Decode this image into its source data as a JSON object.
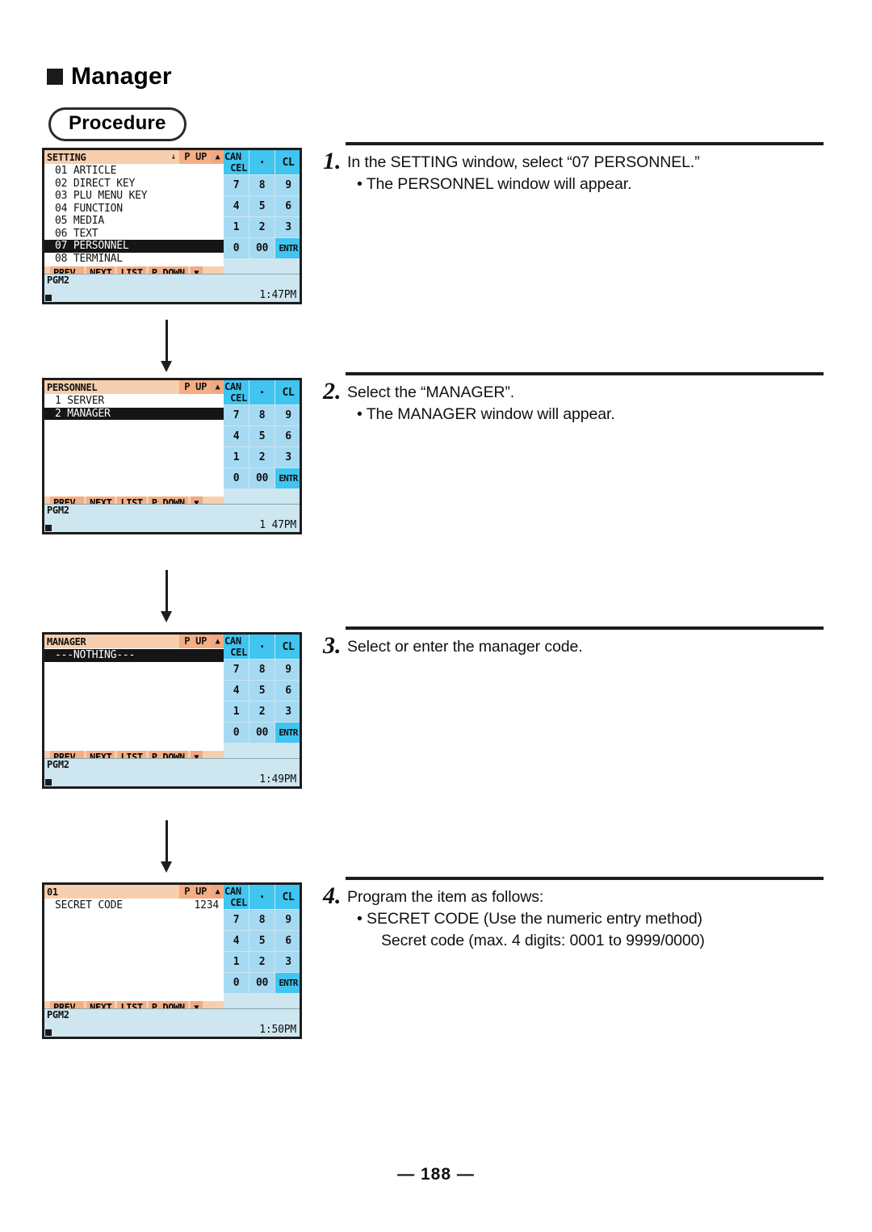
{
  "heading": {
    "bullet_icon": "filled-square",
    "title": "Manager",
    "badge": "Procedure"
  },
  "panels": [
    {
      "id": "setting",
      "title": "SETTING",
      "title_down_arrow": "↓",
      "page_up_label": "P UP",
      "title_up_arrow": "▲",
      "rows": [
        {
          "label": "01 ARTICLE",
          "value": "",
          "selected": false
        },
        {
          "label": "02 DIRECT KEY",
          "value": "",
          "selected": false
        },
        {
          "label": "03 PLU MENU KEY",
          "value": "",
          "selected": false
        },
        {
          "label": "04 FUNCTION",
          "value": "",
          "selected": false
        },
        {
          "label": "05 MEDIA",
          "value": "",
          "selected": false
        },
        {
          "label": "06 TEXT",
          "value": "",
          "selected": false
        },
        {
          "label": "07 PERSONNEL",
          "value": "",
          "selected": true
        },
        {
          "label": "08 TERMINAL",
          "value": "",
          "selected": false
        }
      ],
      "bottom_keys": [
        "PREV.",
        "NEXT",
        "LIST",
        "P DOWN"
      ],
      "bottom_down_arrow": "▼",
      "mode": "PGM2",
      "time": "1:47PM"
    },
    {
      "id": "personnel",
      "title": "PERSONNEL",
      "title_down_arrow": "",
      "page_up_label": "P UP",
      "title_up_arrow": "▲",
      "rows": [
        {
          "label": "1 SERVER",
          "value": "",
          "selected": false
        },
        {
          "label": "2 MANAGER",
          "value": "",
          "selected": true
        }
      ],
      "bottom_keys": [
        "PREV.",
        "NEXT",
        "LIST",
        "P DOWN"
      ],
      "bottom_down_arrow": "▼",
      "mode": "PGM2",
      "time": "1 47PM"
    },
    {
      "id": "manager",
      "title": "MANAGER",
      "title_down_arrow": "",
      "page_up_label": "P UP",
      "title_up_arrow": "▲",
      "rows": [
        {
          "label": "---NOTHING---",
          "value": "",
          "selected": true
        }
      ],
      "bottom_keys": [
        "PREV.",
        "NEXT",
        "LIST",
        "P DOWN"
      ],
      "bottom_down_arrow": "▼",
      "mode": "PGM2",
      "time": "1:49PM"
    },
    {
      "id": "manager-01",
      "title": "01",
      "title_down_arrow": "",
      "page_up_label": "P UP",
      "title_up_arrow": "▲",
      "rows": [
        {
          "label": "SECRET CODE",
          "value": "1234",
          "selected": false
        }
      ],
      "bottom_keys": [
        "PREV.",
        "NEXT",
        "LIST",
        "P DOWN"
      ],
      "bottom_down_arrow": "▼",
      "mode": "PGM2",
      "time": "1:50PM"
    }
  ],
  "keypad": {
    "cancel_top": "CAN",
    "cancel_bottom": "CEL",
    "dot": "·",
    "clear": "CL",
    "keys": [
      "7",
      "8",
      "9",
      "4",
      "5",
      "6",
      "1",
      "2",
      "3",
      "0",
      "00"
    ],
    "enter": "ENTR"
  },
  "steps": [
    {
      "num": "1.",
      "text": "In the SETTING window, select “07 PERSONNEL.”",
      "sub": "• The PERSONNEL window will appear.",
      "sub2": ""
    },
    {
      "num": "2.",
      "text": "Select the “MANAGER”.",
      "sub": "• The MANAGER window will appear.",
      "sub2": ""
    },
    {
      "num": "3.",
      "text": "Select  or enter the manager code.",
      "sub": "",
      "sub2": ""
    },
    {
      "num": "4.",
      "text": "Program the item as follows:",
      "sub": "• SECRET CODE (Use the numeric entry method)",
      "sub2": "Secret code (max. 4 digits: 0001 to 9999/0000)"
    }
  ],
  "footer": {
    "page": "— 188 —"
  },
  "colors": {
    "title_bar": "#f7cfae",
    "key_peach": "#f5ae84",
    "arrow_peach": "#f0a983",
    "status_blue": "#cde6f0",
    "key_blue": "#a6d9f2",
    "key_accent": "#3fc5f0",
    "selection": "#151515"
  }
}
